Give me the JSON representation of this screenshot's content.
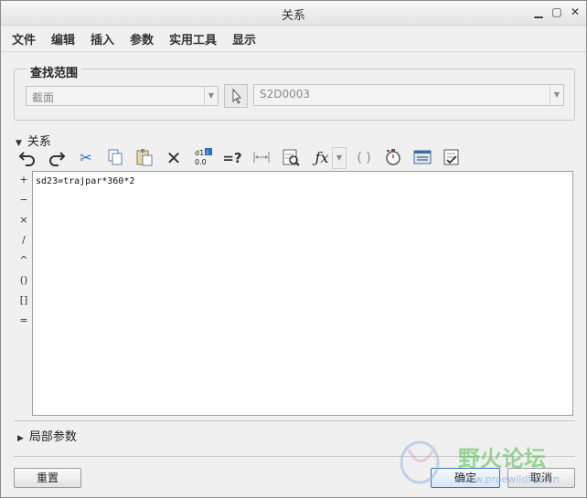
{
  "window": {
    "title": "关系"
  },
  "menu": {
    "items": [
      "文件",
      "编辑",
      "插入",
      "参数",
      "实用工具",
      "显示"
    ]
  },
  "lookup": {
    "legend": "查找范围",
    "type_value": "截面",
    "item_value": "S2D0003"
  },
  "relations": {
    "section_label": "关系",
    "text": "sd23=trajpar*360*2"
  },
  "toolbar": {
    "undo": "↶",
    "redo": "↷",
    "cut": "✂",
    "copy": "⧉",
    "paste": "📋",
    "delete": "✕",
    "switch_dims": "d1\n0.0",
    "evaluate": "=?",
    "dimension": "↔",
    "sort": "🔍",
    "fx": "ƒx",
    "brackets": "()",
    "clock": "⏱",
    "display": "▤",
    "verify": "☑"
  },
  "side_ops": [
    "+",
    "−",
    "×",
    "/",
    "^",
    "()",
    "[]",
    "="
  ],
  "local_params": {
    "label": "局部参数"
  },
  "footer": {
    "reset_label": "重置",
    "ok_label": "确定",
    "cancel_label": "取消"
  },
  "watermark": {
    "text": "野火论坛",
    "url": "www.proewildfire.cn"
  },
  "colors": {
    "accent": "#3a73b8",
    "watermark_green": "#5cc05a"
  }
}
